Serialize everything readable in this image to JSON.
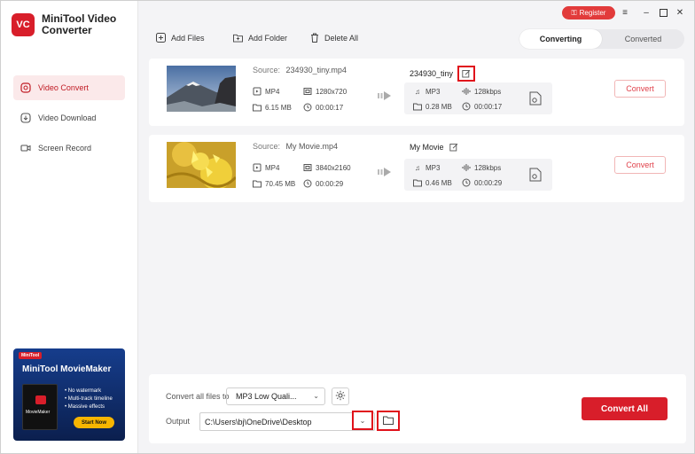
{
  "app": {
    "name": "MiniTool Video Converter",
    "logo_text": "VC"
  },
  "sidebar": {
    "items": [
      {
        "label": "Video Convert",
        "icon": "convert-icon",
        "active": true
      },
      {
        "label": "Video Download",
        "icon": "download-icon",
        "active": false
      },
      {
        "label": "Screen Record",
        "icon": "camera-icon",
        "active": false
      }
    ]
  },
  "promo": {
    "badge": "MiniTool",
    "title": "MiniTool MovieMaker",
    "box_label": "MovieMaker",
    "features": [
      "• No watermark",
      "• Multi-track timeline",
      "• Massive effects"
    ],
    "cta": "Start Now"
  },
  "header": {
    "register_label": "Register"
  },
  "toolbar": {
    "add_files": "Add Files",
    "add_folder": "Add Folder",
    "delete_all": "Delete All"
  },
  "tabs": [
    {
      "label": "Converting",
      "active": true
    },
    {
      "label": "Converted",
      "active": false
    }
  ],
  "files": [
    {
      "source_label": "Source:",
      "source_name": "234930_tiny.mp4",
      "format": "MP4",
      "resolution": "1280x720",
      "size": "6.15 MB",
      "duration": "00:00:17",
      "target_name": "234930_tiny",
      "target_format": "MP3",
      "bitrate": "128kbps",
      "target_size": "0.28 MB",
      "target_duration": "00:00:17",
      "convert_label": "Convert",
      "thumbnail": "mountain"
    },
    {
      "source_label": "Source:",
      "source_name": "My Movie.mp4",
      "format": "MP4",
      "resolution": "3840x2160",
      "size": "70.45 MB",
      "duration": "00:00:29",
      "target_name": "My Movie",
      "target_format": "MP3",
      "bitrate": "128kbps",
      "target_size": "0.46 MB",
      "target_duration": "00:00:29",
      "convert_label": "Convert",
      "thumbnail": "yellow-flower"
    }
  ],
  "bottom": {
    "convert_all_to_label": "Convert all files to",
    "format_value": "MP3 Low Quali...",
    "output_label": "Output",
    "output_path": "C:\\Users\\bj\\OneDrive\\Desktop",
    "convert_all_label": "Convert All"
  },
  "colors": {
    "brand": "#d81e2a",
    "highlight": "#e0121b"
  }
}
